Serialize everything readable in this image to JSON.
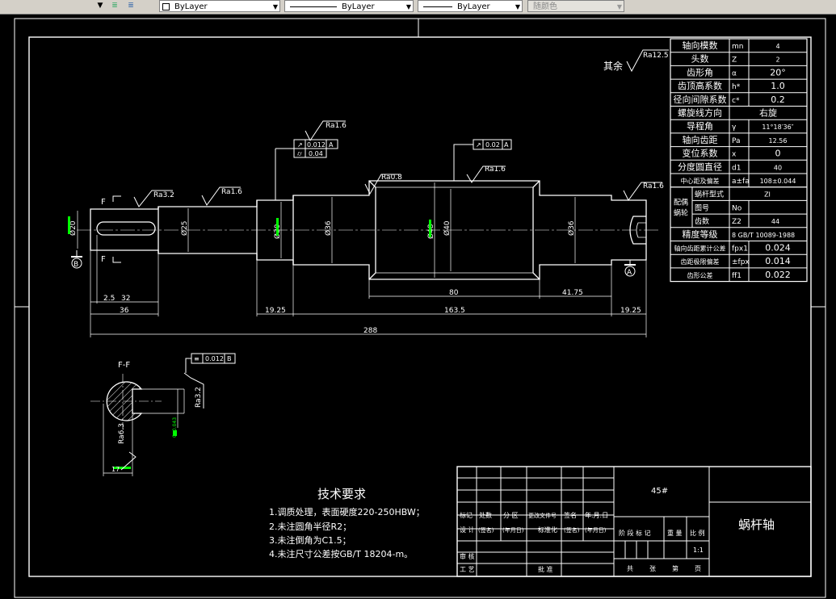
{
  "toolbar": {
    "layer_dropdown_arrow": "▼",
    "color_control": "ByLayer",
    "linetype_control": "ByLayer",
    "lineweight_control": "ByLayer",
    "plotstyle_control": "随颜色"
  },
  "colors": {
    "background": "#000000",
    "lines": "#ffffff",
    "tolerance_text": "#00ff00",
    "toolbar": "#d4d0c8"
  },
  "parameter_table": [
    {
      "label": "轴向模数",
      "symbol": "mn",
      "value": "4"
    },
    {
      "label": "头数",
      "symbol": "Z",
      "value": "2"
    },
    {
      "label": "齿形角",
      "symbol": "α",
      "value": "20°"
    },
    {
      "label": "齿顶高系数",
      "symbol": "h*",
      "value": "1.0"
    },
    {
      "label": "径向间隙系数",
      "symbol": "c*",
      "value": "0.2"
    },
    {
      "label": "螺旋线方向",
      "symbol": "",
      "value": "右旋"
    },
    {
      "label": "导程角",
      "symbol": "γ",
      "value": "11°18′36″"
    },
    {
      "label": "轴向齿距",
      "symbol": "Pa",
      "value": "12.56"
    },
    {
      "label": "变位系数",
      "symbol": "x",
      "value": "0"
    },
    {
      "label": "分度圆直径",
      "symbol": "d1",
      "value": "40"
    },
    {
      "label": "中心距及偏差",
      "symbol": "a±fa",
      "value": "108±0.044"
    }
  ],
  "mating": {
    "group_label": "配偶蜗轮",
    "rows": [
      {
        "label": "蜗杆型式",
        "symbol": "",
        "value": "ZI"
      },
      {
        "label": "图号",
        "symbol": "No",
        "value": ""
      },
      {
        "label": "齿数",
        "symbol": "Z2",
        "value": "44"
      }
    ]
  },
  "accuracy": {
    "label": "精度等级",
    "value": "8 GB/T 10089-1988"
  },
  "deviations": [
    {
      "label": "轴向齿距累计公差",
      "symbol": "fpx1",
      "value": "0.024"
    },
    {
      "label": "齿距极限偏差",
      "symbol": "±fpx",
      "value": "0.014"
    },
    {
      "label": "齿形公差",
      "symbol": "ff1",
      "value": "0.022"
    }
  ],
  "roughness": {
    "other": "其余",
    "other_value": "Ra12.5",
    "r1": "Ra3.2",
    "r2": "Ra1.6",
    "r3": "Ra1.6",
    "r4": "Ra0.8",
    "r5": "Ra1.6",
    "r6": "Ra1.6",
    "r7": "Ra6.3",
    "r8": "Ra3.2"
  },
  "tolerances": {
    "t1_value": "0.012",
    "t1_datum": "A",
    "t2_value": "0.04",
    "t3_value": "0.02",
    "t3_datum": "A",
    "t4_value": "0.012",
    "t4_datum": "B"
  },
  "dimensions": {
    "d_left": "2.5",
    "d_32": "32",
    "d_36": "36",
    "d_19a": "19.25",
    "d_163": "163.5",
    "d_19b": "19.25",
    "d_288": "288",
    "d_80": "80",
    "d_41": "41.75",
    "dia_20": "Ø20",
    "dia_25": "Ø25",
    "dia_30": "Ø30",
    "dia_36a": "Ø36",
    "dia_48": "Ø48",
    "dia_40": "Ø40",
    "dia_36b": "Ø36",
    "sec_17": "17",
    "sec_tol": "0 -0.043"
  },
  "labels": {
    "section_mark": "F",
    "section_title": "F-F",
    "datum_a": "A",
    "datum_b": "B"
  },
  "notes": {
    "title": "技术要求",
    "items": [
      "1.调质处理，表面硬度220-250HBW；",
      "2.未注圆角半径R2；",
      "3.未注倒角为C1.5；",
      "4.未注尺寸公差按GB/T 18204-m。"
    ]
  },
  "title_block": {
    "material": "45#",
    "part_name": "蜗杆轴",
    "row1": [
      "标记",
      "处数",
      "分 区",
      "更改文件号",
      "签名",
      "年.月.日"
    ],
    "row2": [
      "设 计",
      "(签名)",
      "(年月日)",
      "标准化",
      "(签名)",
      "(年月日)"
    ],
    "stage_headers": [
      "阶 段 标 记",
      "重 量",
      "比 例"
    ],
    "scale": "1:1",
    "review": "审 核",
    "process": "工 艺",
    "approve": "批 准",
    "sheets": [
      "共",
      "张",
      "第",
      "页"
    ]
  }
}
